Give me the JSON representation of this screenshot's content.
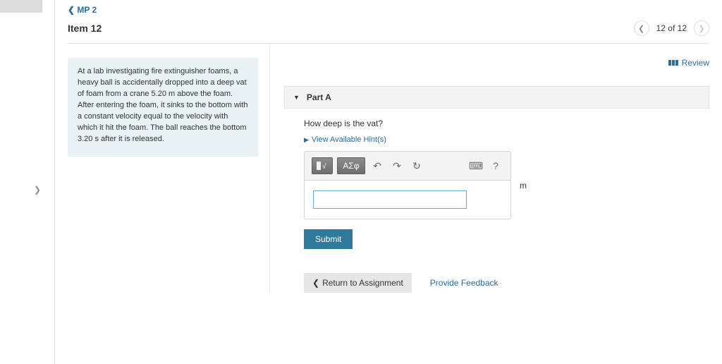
{
  "breadcrumb": {
    "label": "MP 2"
  },
  "item": {
    "title": "Item 12",
    "position": "12 of 12"
  },
  "review": {
    "label": "Review"
  },
  "problem": {
    "text": "At a lab investigating fire extinguisher foams, a heavy ball is accidentally dropped into a deep vat of foam from a crane  5.20 m above the foam. After entering the foam, it sinks to the bottom with a constant velocity equal to the velocity with which it hit the foam. The ball reaches the bottom 3.20 s after it is released."
  },
  "part": {
    "label": "Part A",
    "question": "How deep is the vat?",
    "hints_label": "View Available Hint(s)"
  },
  "toolbar": {
    "templates_label": "√",
    "greek_label": "ΑΣφ"
  },
  "answer": {
    "unit": "m",
    "value": ""
  },
  "actions": {
    "submit": "Submit",
    "return": "Return to Assignment",
    "feedback": "Provide Feedback"
  }
}
